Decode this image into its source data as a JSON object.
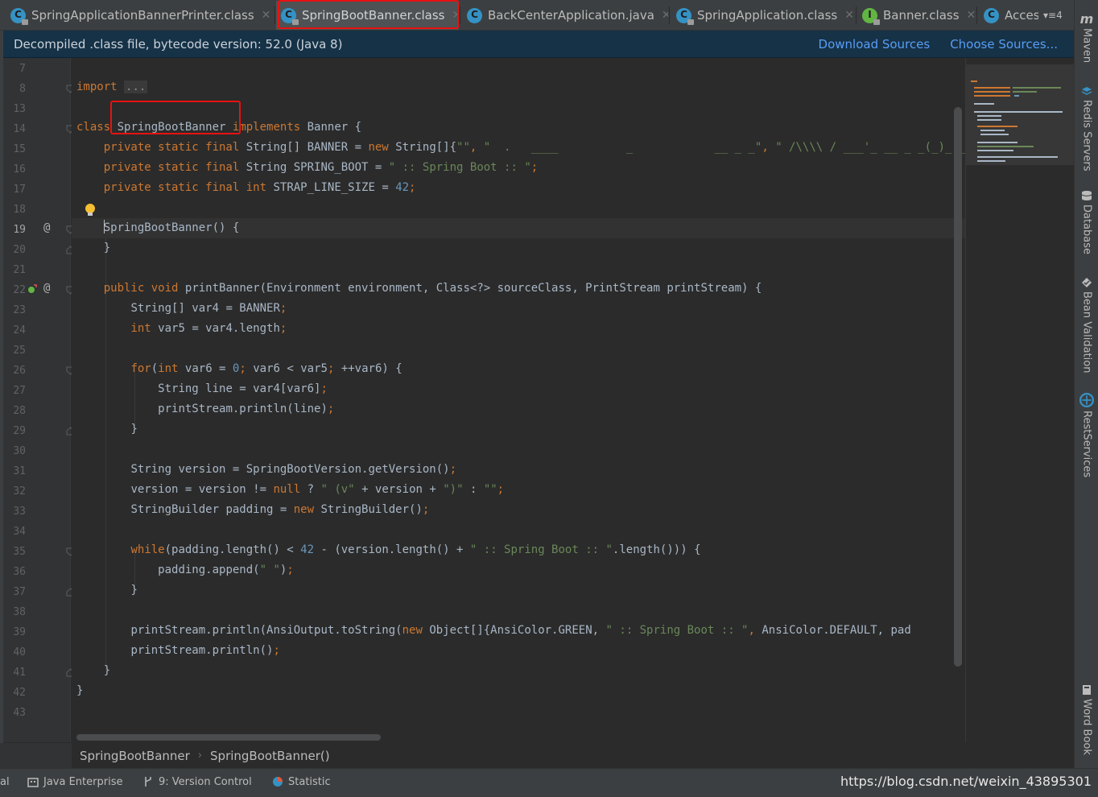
{
  "tabs": [
    {
      "label": "SpringApplicationBannerPrinter.class",
      "icon": "class-icon",
      "letter": "C",
      "closable": true,
      "active": false
    },
    {
      "label": "SpringBootBanner.class",
      "icon": "class-icon",
      "letter": "C",
      "closable": true,
      "active": true
    },
    {
      "label": "BackCenterApplication.java",
      "icon": "class-icon",
      "letter": "C",
      "closable": true,
      "active": false
    },
    {
      "label": "SpringApplication.class",
      "icon": "class-icon",
      "letter": "C",
      "closable": true,
      "active": false
    },
    {
      "label": "Banner.class",
      "icon": "interface-icon",
      "letter": "I",
      "closable": true,
      "active": false
    },
    {
      "label": "Acces",
      "icon": "class-icon",
      "letter": "C",
      "closable": false,
      "active": false
    }
  ],
  "tabs_more": "▾≡4",
  "banner": {
    "text": "Decompiled .class file, bytecode version: 52.0 (Java 8)",
    "download_sources": "Download Sources",
    "choose_sources": "Choose Sources..."
  },
  "line_numbers": [
    "7",
    "8",
    "13",
    "14",
    "15",
    "16",
    "17",
    "18",
    "19",
    "20",
    "21",
    "22",
    "23",
    "24",
    "25",
    "26",
    "27",
    "28",
    "29",
    "30",
    "31",
    "32",
    "33",
    "34",
    "35",
    "36",
    "37",
    "38",
    "39",
    "40",
    "41",
    "42",
    "43"
  ],
  "current_line": "19",
  "gutter_markers": {
    "line19": "@",
    "line22": "@"
  },
  "code": {
    "import_kw": "import",
    "import_folded": "...",
    "class_kw": "class",
    "class_name": "SpringBootBanner",
    "implements_kw": "implements",
    "banner_iface": "Banner {",
    "banner_field_mods": "private static final",
    "banner_field_decl": "String[] BANNER = ",
    "banner_field_new": "new",
    "banner_field_type": "String[]{",
    "banner_str1": "\"\"",
    "banner_comma": ", ",
    "banner_str2": "\"  .   ____          _            __ _ _\"",
    "banner_str3": "\" /\\\\\\\\ / ___'_ __ _ _(_)_ __  __ _ \\\\ \\\\ \\\\ \\\\\"",
    "sb_field_decl": "String SPRING_BOOT = ",
    "sb_field_val": "\" :: Spring Boot :: \"",
    "semicolon": ";",
    "sl_field_decl": "int",
    "sl_field_name": "STRAP_LINE_SIZE = ",
    "sl_field_val": "42",
    "ctor_name": "SpringBootBanner",
    "ctor_rest": "() {",
    "close_brace": "}",
    "pb_public": "public",
    "pb_void": "void",
    "pb_sig": "printBanner(Environment environment, Class<?> sourceClass, PrintStream printStream) {",
    "l23": "String[] var4 = BANNER",
    "l24_int": "int",
    "l24_rest": "var5 = var4.length",
    "l26_for": "for",
    "l26_open": "(",
    "l26_int": "int",
    "l26_a": "var6 = ",
    "l26_zero": "0",
    "l26_b": "var6 < var5",
    "l26_c": "++var6) {",
    "l27": "String line = var4[var6]",
    "l28": "printStream.println(line)",
    "l31": "String version = SpringBootVersion.getVersion()",
    "l32_a": "version = version != ",
    "l32_null": "null",
    "l32_b": "? ",
    "l32_s1": "\" (v\"",
    "l32_c": "+ version + ",
    "l32_s2": "\")\"",
    "l32_d": " : ",
    "l32_s3": "\"\"",
    "l33_a": "StringBuilder padding = ",
    "l33_new": "new",
    "l33_b": "StringBuilder()",
    "l35_while": "while",
    "l35_a": "(padding.length() < ",
    "l35_42": "42",
    "l35_b": " - (version.length() + ",
    "l35_s": "\" :: Spring Boot :: \"",
    "l35_c": ".length())) {",
    "l36_a": "padding.append(",
    "l36_s": "\" \"",
    "l36_b": ")",
    "l39_a": "printStream.println(AnsiOutput.toString(",
    "l39_new": "new",
    "l39_b": "Object[]{AnsiColor.GREEN, ",
    "l39_s": "\" :: Spring Boot :: \"",
    "l39_c": "AnsiColor.DEFAULT, pad",
    "l40": "printStream.println()"
  },
  "breadcrumb": [
    "SpringBootBanner",
    "SpringBootBanner()"
  ],
  "right_tools": [
    "Maven",
    "Redis Servers",
    "Database",
    "Bean Validation",
    "RestServices",
    "Word Book"
  ],
  "bottom_tools": [
    {
      "label": "al"
    },
    {
      "label": "Java Enterprise",
      "icon": "java-enterprise-icon"
    },
    {
      "label": "9: Version Control",
      "icon": "version-control-icon"
    },
    {
      "label": "Statistic",
      "icon": "statistic-icon"
    }
  ],
  "watermark": "https://blog.csdn.net/weixin_43895301",
  "colors": {
    "editor_bg": "#2b2b2b",
    "keyword": "#cc7832",
    "string": "#6a8759",
    "number": "#6897bb",
    "text": "#a9b7c6",
    "highlight_box": "#e81111",
    "link": "#589df6"
  }
}
